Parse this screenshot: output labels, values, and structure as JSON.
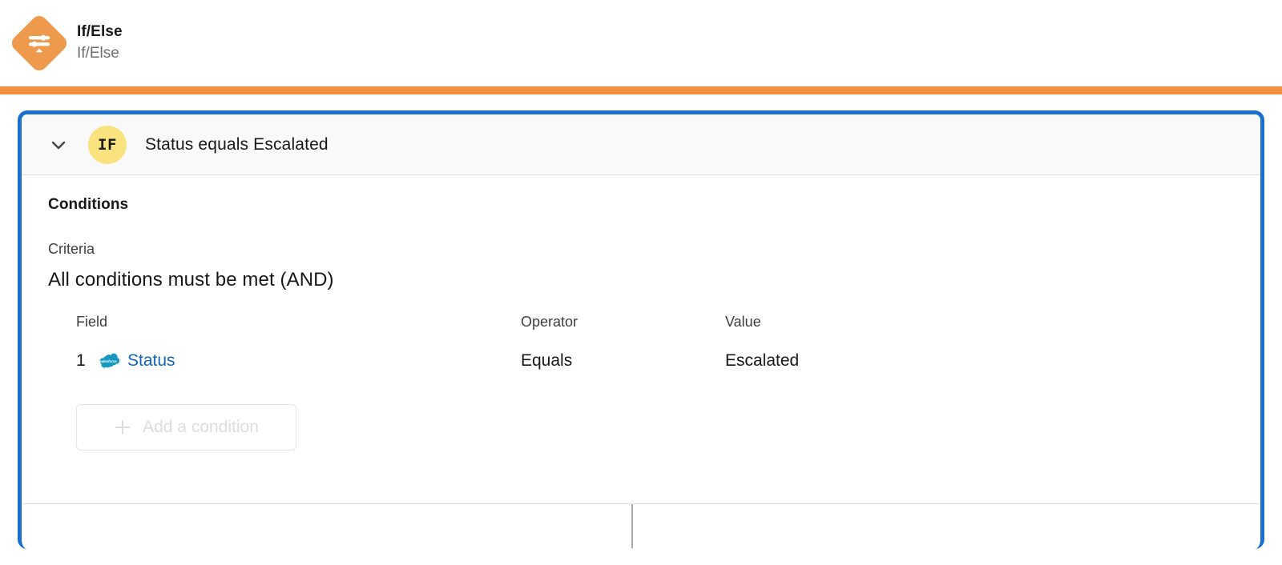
{
  "header": {
    "icon_name": "if-else-node-icon",
    "title": "If/Else",
    "subtitle": "If/Else",
    "accent_color": "#F08F3C",
    "icon_color": "#EE9A4D"
  },
  "card": {
    "selected_border_color": "#1B6FD1",
    "collapse_icon": "chevron-down-icon",
    "badge_label": "IF",
    "badge_color": "#FAE27E",
    "summary": "Status equals Escalated",
    "section_title": "Conditions",
    "criteria_label": "Criteria",
    "criteria_value": "All conditions must be met (AND)",
    "table": {
      "columns": [
        "Field",
        "Operator",
        "Value"
      ],
      "rows": [
        {
          "index": "1",
          "field_icon": "salesforce-cloud-icon",
          "field": "Status",
          "field_link_color": "#1264C0",
          "operator": "Equals",
          "value": "Escalated"
        }
      ]
    },
    "add_condition": {
      "icon": "plus-icon",
      "label": "Add a condition"
    }
  }
}
